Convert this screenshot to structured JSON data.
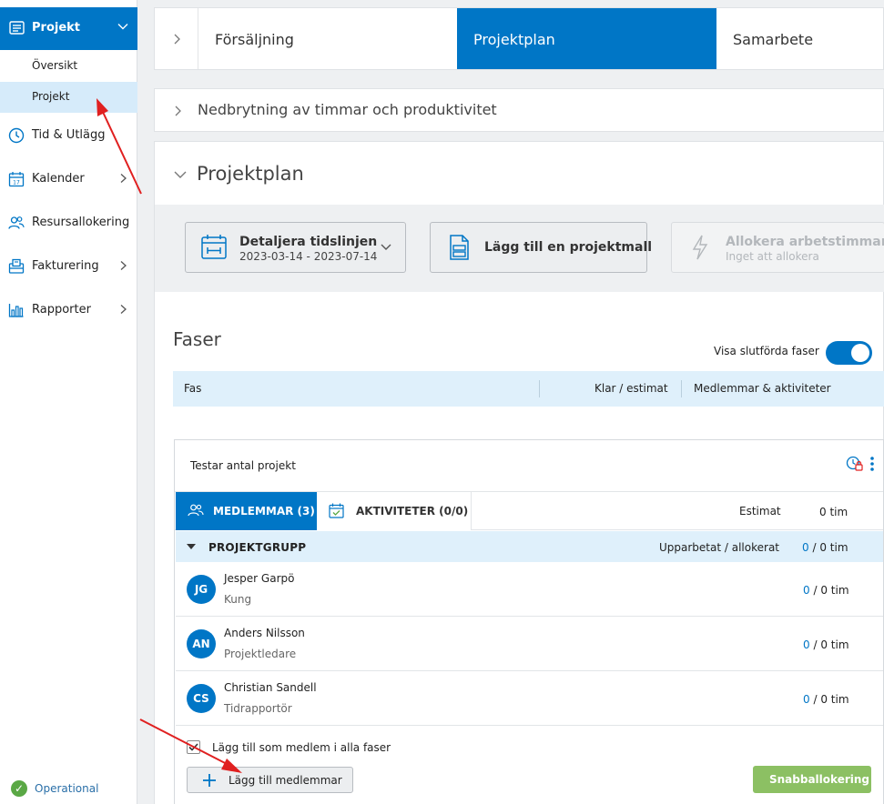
{
  "sidebar": {
    "active_section": "Projekt",
    "sub_items": [
      "Översikt",
      "Projekt"
    ],
    "items": [
      {
        "label": "Tid & Utlägg",
        "icon": "clock-icon"
      },
      {
        "label": "Kalender",
        "icon": "calendar-icon"
      },
      {
        "label": "Resursallokering",
        "icon": "people-icon"
      },
      {
        "label": "Fakturering",
        "icon": "invoice-icon"
      },
      {
        "label": "Rapporter",
        "icon": "bar-chart-icon"
      }
    ],
    "status": "Operational"
  },
  "top_tabs": [
    "Försäljning",
    "Projektplan",
    "Samarbete"
  ],
  "collapsed_section": "Nedbrytning av timmar och produktivitet",
  "plan": {
    "title": "Projektplan",
    "toolbar": {
      "timeline_title": "Detaljera tidslinjen",
      "timeline_dates": "2023-03-14 - 2023-07-14",
      "template_label": "Lägg till en projektmall",
      "allocate_title": "Allokera arbetstimmar",
      "allocate_sub": "Inget att allokera"
    }
  },
  "phases": {
    "title": "Faser",
    "toggle_label": "Visa slutförda faser",
    "columns": [
      "Fas",
      "Klar / estimat",
      "Medlemmar & aktiviteter"
    ]
  },
  "phase": {
    "name": "Testar antal projekt",
    "tabs": [
      "MEDLEMMAR (3)",
      "AKTIVITETER (0/0)"
    ],
    "estimate_label": "Estimat",
    "estimate_value": "0 tim",
    "group": {
      "name": "PROJEKTGRUPP",
      "worked_label": "Upparbetat / allokerat",
      "worked_value": "0",
      "allocated_value": "/ 0 tim"
    },
    "members": [
      {
        "initials": "JG",
        "name": "Jesper Garpö",
        "role": "Kung",
        "worked": "0",
        "allocated": "/ 0 tim"
      },
      {
        "initials": "AN",
        "name": "Anders Nilsson",
        "role": "Projektledare",
        "worked": "0",
        "allocated": "/ 0 tim"
      },
      {
        "initials": "CS",
        "name": "Christian Sandell",
        "role": "Tidrapportör",
        "worked": "0",
        "allocated": "/ 0 tim"
      }
    ],
    "checkbox_label": "Lägg till som medlem i alla faser",
    "add_members_label": "Lägg till medlemmar",
    "quick_alloc_label": "Snabballokering"
  },
  "colors": {
    "primary": "#0076c6",
    "highlight": "#dff0fb",
    "success": "#8cc063",
    "annotation": "#e02020"
  }
}
